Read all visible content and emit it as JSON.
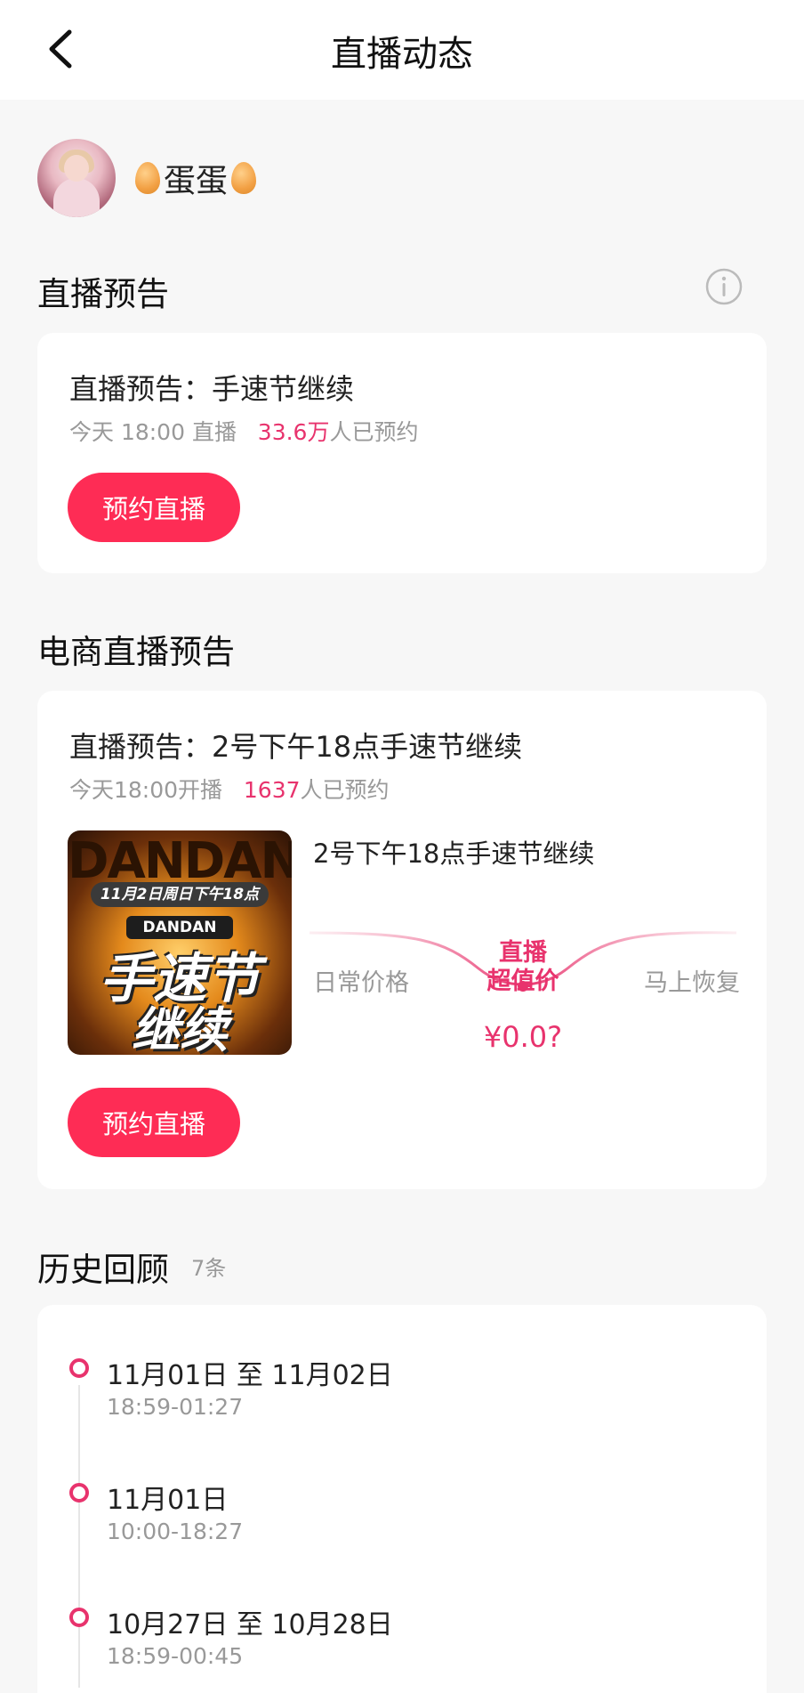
{
  "header": {
    "title": "直播动态",
    "back_icon": "chevron-left-icon"
  },
  "profile": {
    "name": "蛋蛋",
    "emoji_icon": "egg-icon"
  },
  "live_preview": {
    "section_title": "直播预告",
    "info_icon": "info-icon",
    "card": {
      "title": "直播预告：手速节继续",
      "time_text": "今天 18:00 直播",
      "count": "33.6万",
      "count_suffix": "人已预约",
      "button": "预约直播"
    }
  },
  "ecommerce_preview": {
    "section_title": "电商直播预告",
    "card": {
      "title": "直播预告：2号下午18点手速节继续",
      "time_text": "今天18:00开播",
      "count": "1637",
      "count_suffix": "人已预约",
      "poster": {
        "brand": "DANDAN",
        "date_banner": "11月2日周日下午18点",
        "brand_small": "DANDAN",
        "headline_1": "手速节",
        "headline_2": "继续"
      },
      "product_title": "2号下午18点手速节继续",
      "price_compare": {
        "left": "日常价格",
        "mid_line1": "直播",
        "mid_line2": "超值价",
        "right": "马上恢复",
        "price": "¥0.0?"
      },
      "button": "预约直播",
      "accent_color": "#fe2c55"
    }
  },
  "history": {
    "section_title": "历史回顾",
    "count": "7条",
    "items": [
      {
        "date": "11月01日 至 11月02日",
        "time": "18:59-01:27"
      },
      {
        "date": "11月01日",
        "time": "10:00-18:27"
      },
      {
        "date": "10月27日 至 10月28日",
        "time": "18:59-00:45"
      }
    ]
  }
}
